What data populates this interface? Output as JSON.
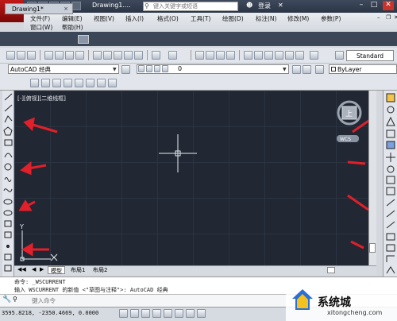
{
  "title_bar": {
    "doc_title": "Drawing1....",
    "search_placeholder": "键入关键字或短语",
    "login_label": "登录"
  },
  "menu": {
    "row1": [
      "文件(F)",
      "编辑(E)",
      "视图(V)",
      "插入(I)",
      "格式(O)",
      "工具(T)",
      "绘图(D)",
      "标注(N)",
      "修改(M)",
      "参数(P)"
    ],
    "row2": [
      "窗口(W)",
      "帮助(H)"
    ]
  },
  "tabs": {
    "doc_tab": "Drawing1*",
    "close": "×"
  },
  "toolbar": {
    "workspace": "AutoCAD 经典",
    "layer_value": "0",
    "bylayer": "ByLayer",
    "text_style": "Standard"
  },
  "canvas": {
    "viewport_label": "[-][俯视][二维线框]",
    "viewcube_top": "上",
    "wcs_label": "WCS"
  },
  "layout_tabs": [
    "模型",
    "布局1",
    "布局2"
  ],
  "command": {
    "history": [
      "命令: _WSCURRENT",
      "输入 WSCURRENT 的新值 <\"草图与注释\">: AutoCAD 经典"
    ],
    "input_placeholder": "键入命令"
  },
  "status": {
    "coords": "3595.8218, -2350.4669, 0.0000"
  },
  "watermark": {
    "name": "系统城",
    "url": "xitongcheng.com"
  },
  "colors": {
    "canvas_bg": "#212733",
    "annotation_arrow": "#e0202a",
    "app_logo": "#c01818"
  }
}
